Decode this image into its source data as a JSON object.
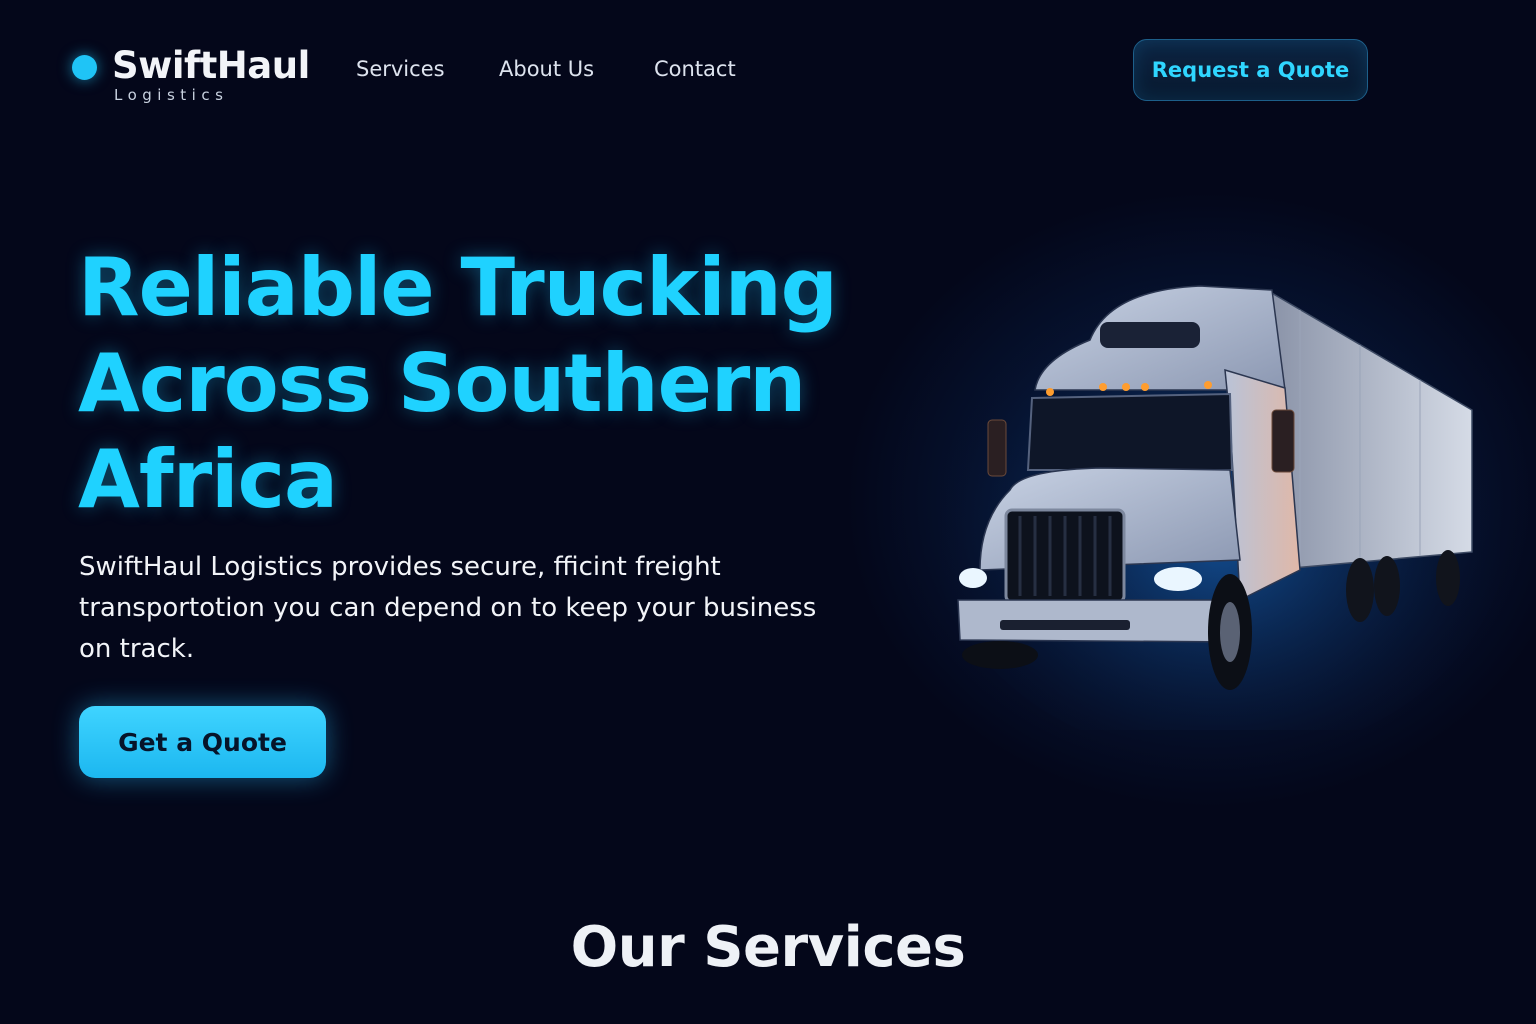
{
  "brand": {
    "name": "SwiftHaul",
    "tagline": "Logistics",
    "accent_color": "#1fd2ff"
  },
  "nav": {
    "items": [
      {
        "label": "Services"
      },
      {
        "label": "About Us"
      },
      {
        "label": "Contact"
      }
    ],
    "cta_label": "Request a Quote"
  },
  "hero": {
    "title_lines": [
      "Reliable Trucking",
      "Across Southern",
      "Africa"
    ],
    "description": "SwiftHaul Logistics provides secure, fficint freight transportotion you can depend on to keep your business on track.",
    "cta_label": "Get a Quote",
    "image_icon": "semi-truck-illustration"
  },
  "services_section": {
    "title": "Our Services"
  }
}
